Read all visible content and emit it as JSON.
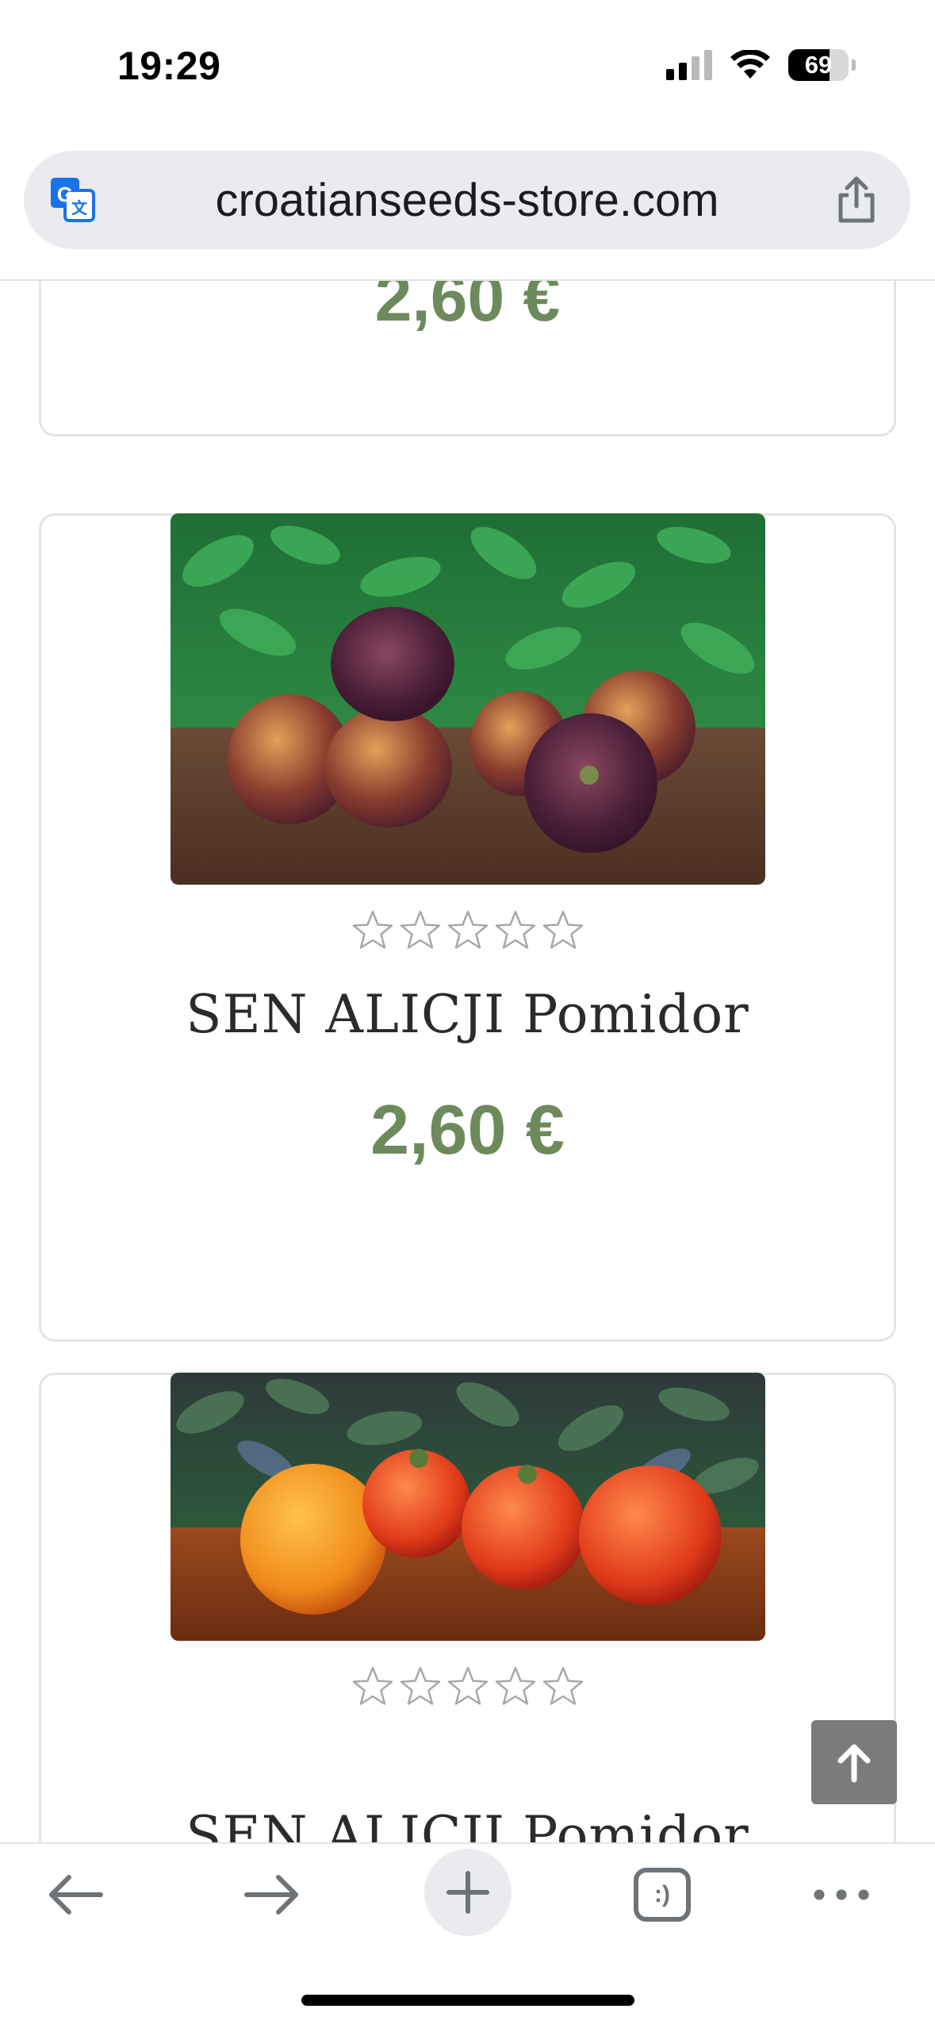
{
  "status_bar": {
    "time": "19:29",
    "battery_percent": "69",
    "battery_level": 0.69,
    "signal_bars_active": 2,
    "signal_bars_total": 4,
    "icons": [
      "cellular-signal-icon",
      "wifi-icon",
      "battery-icon"
    ]
  },
  "browser": {
    "url": "croatianseeds-store.com",
    "left_icon": "translate-icon",
    "right_icon": "share-icon"
  },
  "products": {
    "previous_card": {
      "price": "2,60 €"
    },
    "items": [
      {
        "image_description": "dark purple striped tomatoes on wooden table",
        "rating": 0,
        "rating_max": 5,
        "name": "SEN ALICJI Pomidor",
        "price": "2,60 €"
      },
      {
        "image_description": "orange-red striped tomatoes on wooden table",
        "rating": 0,
        "rating_max": 5,
        "name": "SEN ALICJI Pomidor"
      }
    ]
  },
  "scroll_to_top": {
    "icon": "arrow-up-icon"
  },
  "toolbar": {
    "back_icon": "arrow-left-icon",
    "forward_icon": "arrow-right-icon",
    "new_tab_icon": "plus-icon",
    "tabs_label": ":)",
    "more_icon": "more-dots-icon"
  },
  "colors": {
    "price_green": "#6d8a5d",
    "card_border": "#e4e4e4",
    "url_bar_bg": "#e9ebee",
    "scroll_button": "#7b7b7b"
  }
}
